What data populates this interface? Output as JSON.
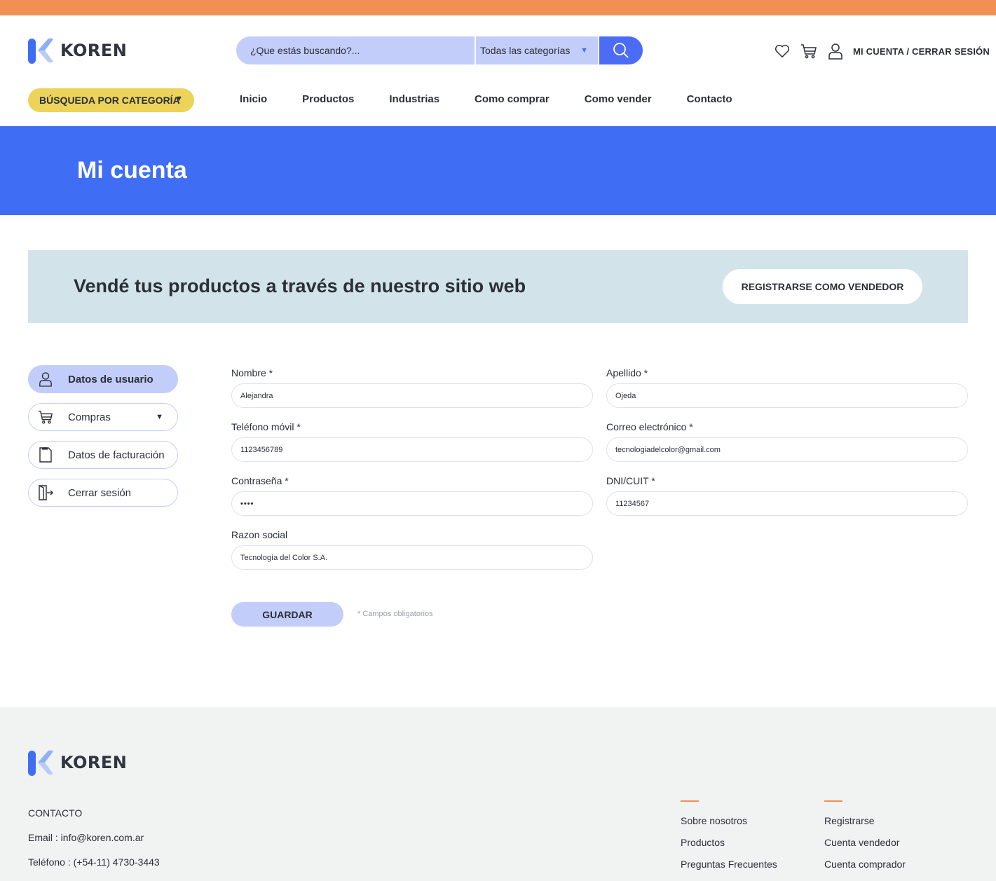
{
  "colors": {
    "top_bar": "#f28f52",
    "brand_blue": "#3f6ef5",
    "light_blue": "#c3cdfa",
    "yellow": "#ecd35a",
    "banner_bg": "#d2e4ea",
    "footer_bg": "#f1f2f2"
  },
  "header": {
    "logo_text": "KOREN",
    "search_placeholder": "¿Que estás buscando?...",
    "category_select": "Todas las categorías",
    "account_link": "MI CUENTA / CERRAR SESIÓN",
    "icons": [
      "heart-icon",
      "cart-icon",
      "user-icon",
      "search-icon"
    ]
  },
  "nav": {
    "category_button": "BÚSQUEDA POR CATEGORÍA",
    "items": [
      "Inicio",
      "Productos",
      "Industrias",
      "Como comprar",
      "Como vender",
      "Contacto"
    ]
  },
  "hero": {
    "title": "Mi cuenta"
  },
  "banner": {
    "text": "Vendé tus productos a través de nuestro sitio web",
    "button": "REGISTRARSE COMO VENDEDOR"
  },
  "sidebar": {
    "items": [
      {
        "label": "Datos de usuario",
        "icon": "user-icon"
      },
      {
        "label": "Compras",
        "icon": "cart-icon"
      },
      {
        "label": "Datos de facturación",
        "icon": "receipt-icon"
      },
      {
        "label": "Cerrar sesión",
        "icon": "logout-icon"
      }
    ]
  },
  "form": {
    "nombre": {
      "label": "Nombre *",
      "value": "Alejandra"
    },
    "apellido": {
      "label": "Apellido *",
      "value": "Ojeda"
    },
    "telefono": {
      "label": "Teléfono móvil *",
      "value": "1123456789"
    },
    "correo": {
      "label": "Correo electrónico *",
      "value": "tecnologiadelcolor@gmail.com"
    },
    "contrasena": {
      "label": "Contraseña *",
      "value": "••••"
    },
    "dni": {
      "label": "DNI/CUIT *",
      "value": "11234567"
    },
    "razon": {
      "label": "Razon social",
      "value": "Tecnología del Color S.A."
    },
    "save_button": "GUARDAR",
    "required_note": "* Campos obligatorios"
  },
  "footer": {
    "logo_text": "KOREN",
    "contact_title": "CONTACTO",
    "email": "Email : info@koren.com.ar",
    "phone": "Teléfono : (+54-11) 4730-3443",
    "col1": [
      "Sobre nosotros",
      "Productos",
      "Preguntas Frecuentes"
    ],
    "col2": [
      "Registrarse",
      "Cuenta vendedor",
      "Cuenta comprador"
    ]
  }
}
